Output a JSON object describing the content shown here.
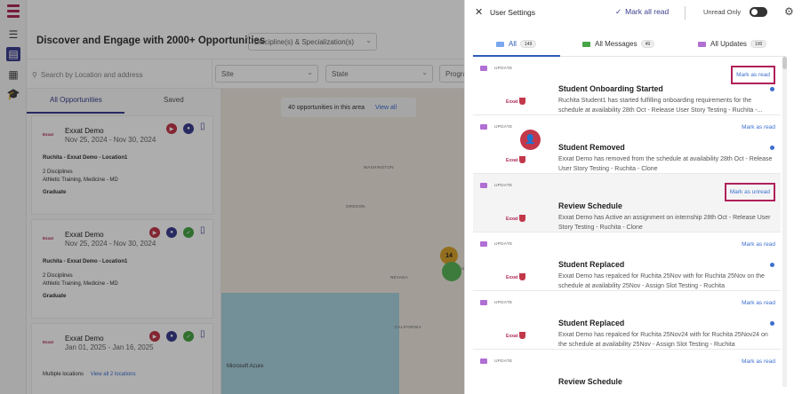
{
  "app": {
    "page_title": "Discover and Engage with 2000+ Opportunities",
    "filters": {
      "discipline_placeholder": "Discipline(s) & Specialization(s)",
      "search_placeholder": "Search by Location and address",
      "site": "Site",
      "state": "State",
      "program": "Progra"
    },
    "list_tabs": [
      "All Opportunities",
      "Saved"
    ],
    "cards": [
      {
        "logo_text": "Exxat",
        "name": "Exxat Demo",
        "date": "Nov 25, 2024 - Nov 30, 2024",
        "location": "Ruchita - Exxat Demo - Location1",
        "disciplines_count": "2 Disciplines",
        "disciplines": "Athletic Training, Medicine - MD",
        "level": "Graduate"
      },
      {
        "logo_text": "Exxat",
        "name": "Exxat Demo",
        "date": "Nov 25, 2024 - Nov 30, 2024",
        "location": "Ruchita - Exxat Demo - Location1",
        "disciplines_count": "2 Disciplines",
        "disciplines": "Athletic Training, Medicine - MD",
        "level": "Graduate"
      },
      {
        "logo_text": "Exxat",
        "name": "Exxat Demo",
        "date": "Jan 01, 2025 - Jan 16, 2025",
        "location": "Multiple locations",
        "view_all": "View all 2 locations"
      }
    ],
    "map": {
      "chip_text": "40 opportunities in this area",
      "chip_link": "View all",
      "cluster_count": "14",
      "labels": [
        "WASHINGTON",
        "OREGON",
        "NEVADA",
        "CALIFORNIA",
        "UTAH"
      ],
      "attribution": "Microsoft Azure"
    }
  },
  "drawer": {
    "title": "User Settings",
    "mark_all_read": "Mark all read",
    "unread_only": "Unread Only",
    "tabs": [
      {
        "label": "All",
        "count": "149"
      },
      {
        "label": "All Messages",
        "count": "49"
      },
      {
        "label": "All Updates",
        "count": "100"
      }
    ],
    "notifications": [
      {
        "tag": "UPDATE",
        "action": "Mark as read",
        "logo": "Exxat",
        "title": "Student Onboarding Started",
        "body": "Ruchita Student1 has started fulfilling onboarding requirements for the schedule at availability 28th Oct - Release User Story Testing - Ruchita -...",
        "unread": true
      },
      {
        "tag": "UPDATE",
        "action": "Mark as read",
        "logo": "Exxat",
        "title": "Student Removed",
        "body": "Exxat Demo has removed from the schedule at availability 28th Oct - Release User Story Testing - Ruchita - Clone",
        "unread": true
      },
      {
        "tag": "UPDATE",
        "action": "Mark as unread",
        "logo": "Exxat",
        "title": "Review Schedule",
        "body": "Exxat Demo has Active an assignment on internship 28th Oct - Release User Story Testing - Ruchita - Clone",
        "unread": false
      },
      {
        "tag": "UPDATE",
        "action": "Mark as read",
        "logo": "Exxat",
        "title": "Student Replaced",
        "body": "Exxat Demo has repalced for Ruchita 25Nov with for Ruchita 25Nov on the schedule at availability 25Nov - Assign Slot Testing - Ruchita",
        "unread": true
      },
      {
        "tag": "UPDATE",
        "action": "Mark as read",
        "logo": "Exxat",
        "title": "Student Replaced",
        "body": "Exxat Demo has repalced for Ruchita 25Nov24 with for Ruchita 25Nov24 on the schedule at availability 25Nov - Assign Slot Testing - Ruchita",
        "unread": true
      },
      {
        "tag": "UPDATE",
        "action": "Mark as read",
        "logo": "Exxat",
        "title": "Review Schedule",
        "body": "",
        "unread": true
      }
    ]
  },
  "colors": {
    "brand": "#3c3f8f",
    "accent_link": "#3c6fd1",
    "highlight_box": "#b0205a",
    "logo_red": "#c2384a"
  }
}
